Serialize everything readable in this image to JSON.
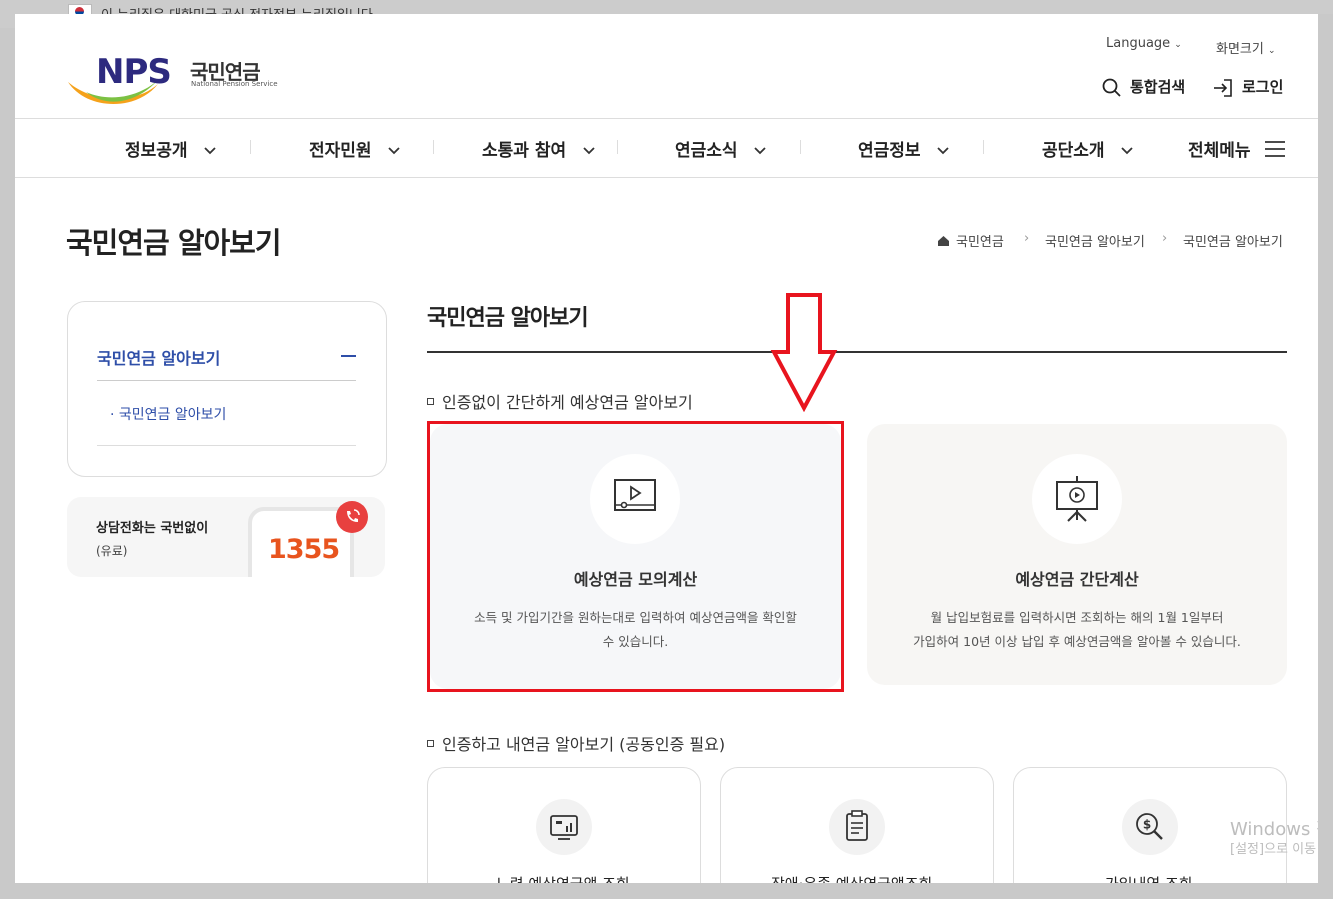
{
  "gov_banner": "이 누리집은 대한민국 공식 전자정부 누리집입니다.",
  "logo": {
    "brand": "NPS",
    "name_kr": "국민연금",
    "name_en": "National Pension Service"
  },
  "util": {
    "language": "Language",
    "font_size": "화면크기",
    "search": "통합검색",
    "login": "로그인"
  },
  "nav": {
    "items": [
      "정보공개",
      "전자민원",
      "소통과 참여",
      "연금소식",
      "연금정보",
      "공단소개"
    ],
    "all_menu": "전체메뉴"
  },
  "page_title": "국민연금 알아보기",
  "breadcrumb": [
    "국민연금",
    "국민연금 알아보기",
    "국민연금 알아보기"
  ],
  "lnb": {
    "title": "국민연금 알아보기",
    "sub_item": "· 국민연금 알아보기"
  },
  "callbox": {
    "line1": "상담전화는 국번없이",
    "line2": "(유료)",
    "number": "1355"
  },
  "section": {
    "title": "국민연금 알아보기",
    "sub1": "인증없이 간단하게 예상연금 알아보기",
    "sub2": "인증하고 내연금 알아보기 (공동인증 필요)"
  },
  "cards": [
    {
      "title": "예상연금 모의계산",
      "desc1": "소득 및 가입기간을 원하는대로 입력하여 예상연금액을 확인할",
      "desc2": "수 있습니다."
    },
    {
      "title": "예상연금 간단계산",
      "desc1": "월 납입보험료를 입력하시면 조회하는 해의 1월 1일부터",
      "desc2": "가입하여 10년 이상 납입 후 예상연금액을 알아볼 수 있습니다."
    }
  ],
  "cards_auth": [
    "노령 예상연금액 조회",
    "장애·유족 예상연금액조회",
    "가입내역 조회"
  ],
  "watermark": {
    "line1": "Windows 정",
    "line2": "[설정]으로 이동"
  },
  "colors": {
    "accent_blue": "#2e4ea8",
    "highlight_red": "#e8141e"
  }
}
